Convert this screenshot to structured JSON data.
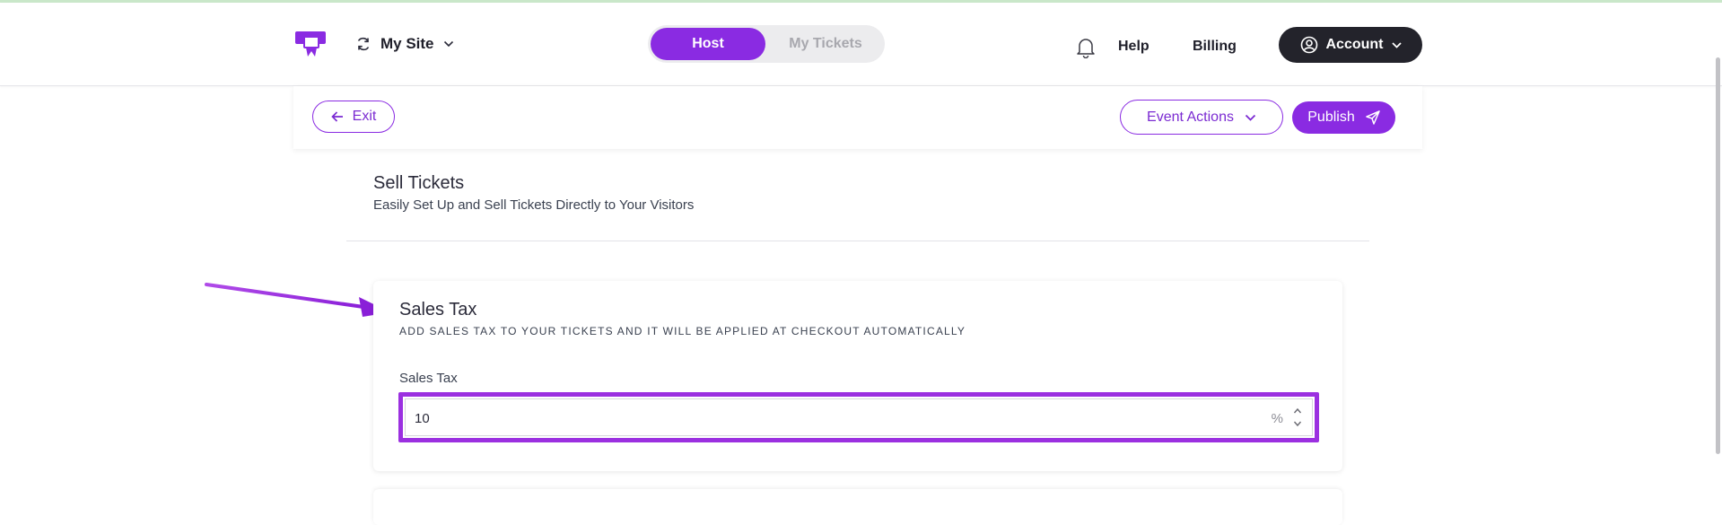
{
  "header": {
    "site_label": "My Site",
    "segment": {
      "host_label": "Host",
      "tickets_label": "My Tickets",
      "active": "Host"
    },
    "help_label": "Help",
    "billing_label": "Billing",
    "account_label": "Account"
  },
  "toolbar": {
    "exit_label": "Exit",
    "event_actions_label": "Event Actions",
    "publish_label": "Publish"
  },
  "section": {
    "title": "Sell Tickets",
    "subtitle": "Easily Set Up and Sell Tickets Directly to Your Visitors"
  },
  "sales_tax_card": {
    "title": "Sales Tax",
    "description": "ADD SALES TAX TO YOUR TICKETS AND IT WILL BE APPLIED AT CHECKOUT AUTOMATICALLY",
    "field_label": "Sales Tax",
    "field_value": "10",
    "field_unit": "%"
  },
  "icons": {
    "logo": "ticket-logo-icon",
    "site_switch": "sync-icon",
    "site_dropdown": "chevron-down-icon",
    "notifications": "bell-icon",
    "account": "user-circle-icon",
    "exit": "arrow-left-icon",
    "publish": "send-icon"
  },
  "colors": {
    "accent": "#8a2be2",
    "highlight": "#9b30e0",
    "account_bg": "#23232b"
  }
}
